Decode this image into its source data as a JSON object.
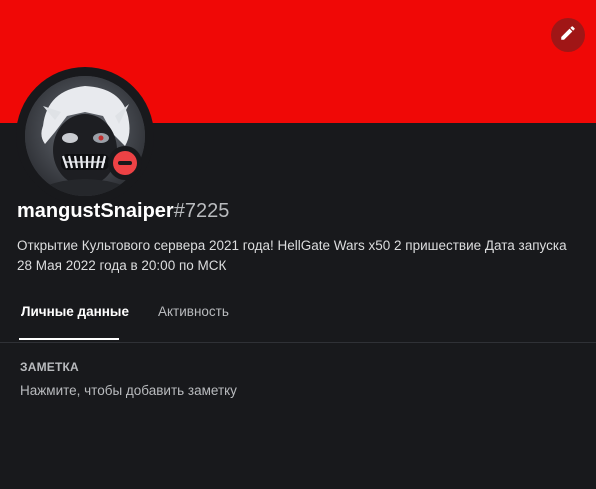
{
  "banner": {
    "color": "#f00806"
  },
  "edit_button": {
    "icon": "pencil-icon"
  },
  "status": {
    "state": "do-not-disturb",
    "color": "#ed4245"
  },
  "user": {
    "username": "mangustSnaiper",
    "discriminator": "#7225",
    "bio": "Открытие Культового сервера 2021 года! HellGate Wars x50 2 пришествие Дата запуска 28 Мая 2022 года в 20:00 по МСК"
  },
  "tabs": [
    {
      "label": "Личные данные",
      "active": true
    },
    {
      "label": "Активность",
      "active": false
    }
  ],
  "note": {
    "title": "ЗАМЕТКА",
    "placeholder": "Нажмите, чтобы добавить заметку"
  }
}
